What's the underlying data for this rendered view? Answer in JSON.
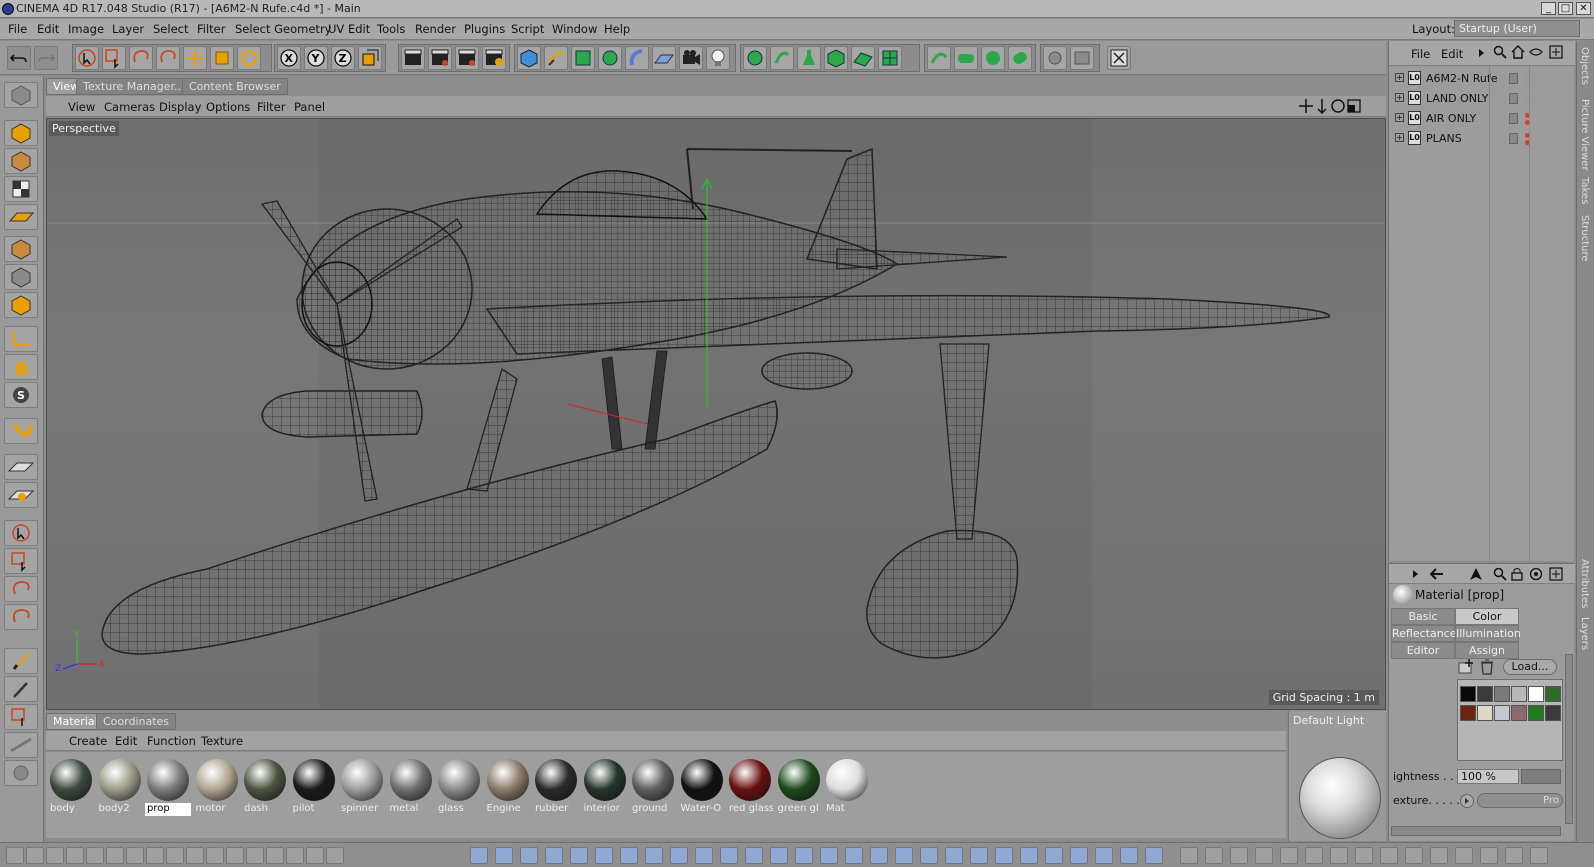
{
  "window": {
    "title": "CINEMA 4D R17.048 Studio (R17) - [A6M2-N Rufe.c4d *] - Main",
    "controls": [
      "_",
      "□",
      "✕"
    ]
  },
  "menu": [
    "File",
    "Edit",
    "Image",
    "Layer",
    "Select",
    "Filter",
    "Select Geometry",
    "UV Edit",
    "Tools",
    "Render",
    "Plugins",
    "Script",
    "Window",
    "Help"
  ],
  "layout": {
    "label": "Layout:",
    "value": "Startup (User)"
  },
  "viewport": {
    "tabs": [
      "View",
      "Texture Manager...",
      "Content Browser"
    ],
    "menu": [
      "View",
      "Cameras",
      "Display",
      "Options",
      "Filter",
      "Panel"
    ],
    "camera_label": "Perspective",
    "grid_spacing": "Grid Spacing : 1 m",
    "axis_labels": [
      "Y",
      "Z",
      "X"
    ]
  },
  "materials": {
    "tabs": [
      "Materials",
      "Coordinates"
    ],
    "menu": [
      "Create",
      "Edit",
      "Function",
      "Texture"
    ],
    "items": [
      {
        "name": "body",
        "color": "#3d4a3d"
      },
      {
        "name": "body2",
        "color": "#9a9c88"
      },
      {
        "name": "prop",
        "color": "#7c7c7c"
      },
      {
        "name": "motor",
        "color": "#b0a58f"
      },
      {
        "name": "dash",
        "color": "#4a5540"
      },
      {
        "name": "pilot",
        "color": "#1a1a1a"
      },
      {
        "name": "spinner",
        "color": "#9c9c9c"
      },
      {
        "name": "metal",
        "color": "#6f6f6f"
      },
      {
        "name": "glass",
        "color": "#8a8a8a"
      },
      {
        "name": "Engine",
        "color": "#8a7a6a"
      },
      {
        "name": "rubber",
        "color": "#2a2a2a"
      },
      {
        "name": "interior",
        "color": "#24352a"
      },
      {
        "name": "ground",
        "color": "#5e5e5e"
      },
      {
        "name": "Water-O",
        "color": "#111111"
      },
      {
        "name": "red glass",
        "color": "#6a1010"
      },
      {
        "name": "green gl",
        "color": "#1c4a1c"
      },
      {
        "name": "Mat",
        "color": "#dcdcdc"
      }
    ],
    "selected": "prop",
    "preview_label": "Default Light"
  },
  "objects": {
    "menu": [
      "File",
      "Edit"
    ],
    "items": [
      {
        "name": "A6M2-N Rufe",
        "dot": "#999999"
      },
      {
        "name": "LAND ONLY",
        "dot": "#999999"
      },
      {
        "name": "AIR ONLY",
        "dot": "#d04030"
      },
      {
        "name": "PLANS",
        "dot": "#d04030"
      }
    ]
  },
  "attributes": {
    "title": "Material [prop]",
    "tabs": [
      "Basic",
      "Color",
      "Reflectance",
      "Illumination",
      "Editor",
      "Assign"
    ],
    "active_tab": "Color",
    "load_label": "Load...",
    "brightness_label": "ightness . . . .",
    "brightness_value": "100 %",
    "texture_label": "exture. . . . . .",
    "texture_value": "Pro",
    "swatches": [
      "#0a0a0a",
      "#3a3a3a",
      "#7a7a7a",
      "#b8b8b8",
      "#ffffff",
      "#2f6a2a",
      "#6a2410",
      "#ddd8c8",
      "#c8c8d4",
      "#8a6a6a",
      "#1e7a1e",
      "#3a3a3a"
    ]
  },
  "side_tabs": [
    "Objects",
    "Picture Viewer",
    "Takes",
    "Structure",
    "Attributes",
    "Layers"
  ],
  "colors": {
    "accent_green": "#1e9e3a",
    "axis_red": "#d22",
    "axis_green": "#2c2",
    "axis_blue": "#33f"
  }
}
